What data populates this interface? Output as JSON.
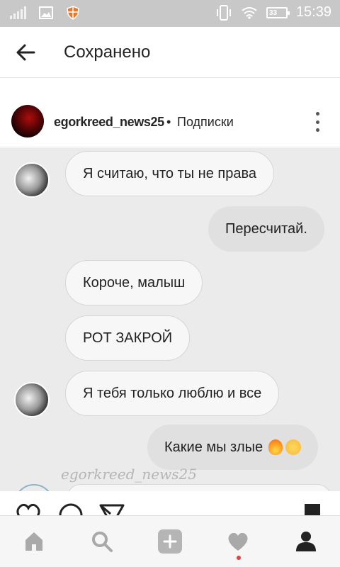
{
  "status_bar": {
    "time": "15:39",
    "battery_level": "33"
  },
  "header": {
    "title": "Сохранено",
    "back_icon": "arrow-left-icon"
  },
  "post": {
    "username": "egorkreed_news25",
    "separator": "•",
    "follow_label": "Подписки",
    "menu_icon": "more-vertical-icon"
  },
  "chat": {
    "messages": [
      {
        "side": "in",
        "text": "Я считаю, что ты не права",
        "avatar": true
      },
      {
        "side": "out",
        "text": "Пересчитай."
      },
      {
        "side": "in",
        "text": "Короче, малыш",
        "avatar": false
      },
      {
        "side": "in",
        "text": "РОТ ЗАКРОЙ",
        "avatar": false
      },
      {
        "side": "in",
        "text": "Я тебя только люблю и все",
        "avatar": true
      },
      {
        "side": "out",
        "text": "Какие мы злые",
        "emoji": [
          "fire",
          "face-with-tears-of-joy"
        ]
      }
    ],
    "watermark": "egorkreed_news25"
  },
  "bottom_nav": {
    "items": [
      "home-icon",
      "search-icon",
      "add-icon",
      "activity-heart-icon",
      "profile-icon"
    ],
    "active": "profile-icon"
  },
  "colors": {
    "status_bar": "#c8c8c8",
    "chat_bg": "#ebebeb",
    "notification_dot": "#e0413a"
  }
}
